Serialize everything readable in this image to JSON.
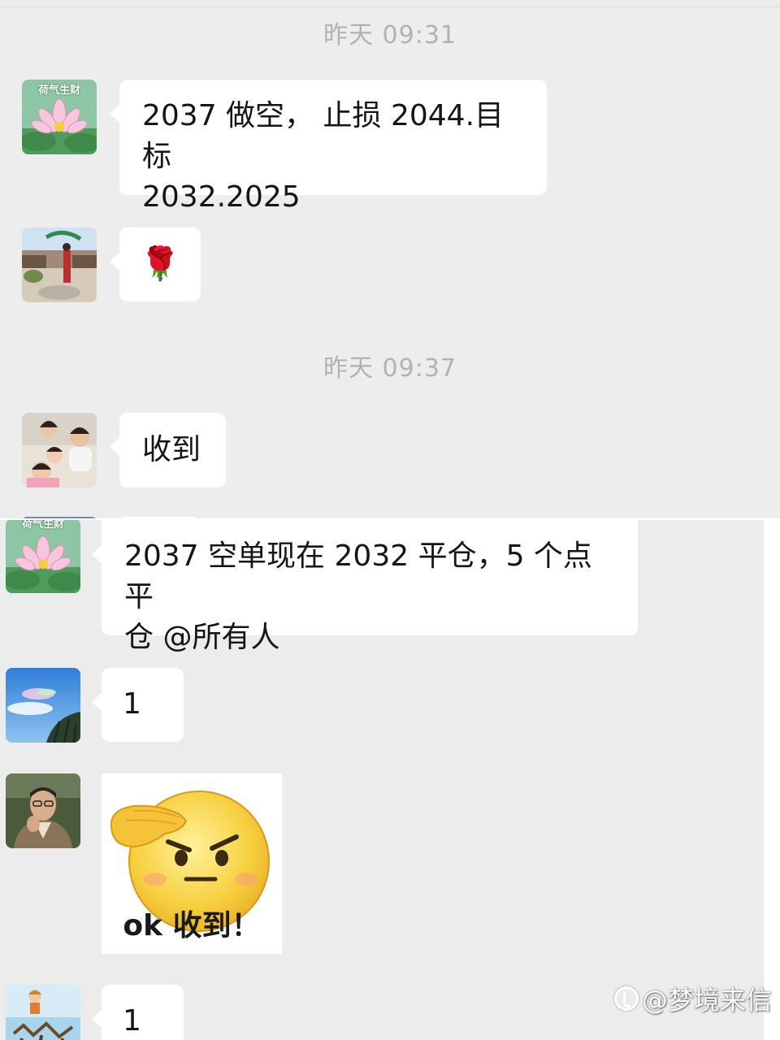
{
  "screen_one": {
    "timestamps": [
      "昨天 09:31",
      "昨天 09:37"
    ],
    "messages": [
      {
        "sender_avatar": "lotus-avatar",
        "avatar_label": "荷气生财",
        "text_lines": [
          "2037 做空，  止损 2044.目标",
          "2032.2025"
        ]
      },
      {
        "sender_avatar": "outdoor-photo-avatar",
        "emoji": "🌹"
      },
      {
        "sender_avatar": "family-photo-avatar",
        "text_lines": [
          "收到"
        ]
      }
    ]
  },
  "screen_two": {
    "messages": [
      {
        "sender_avatar": "lotus-avatar",
        "avatar_label": "荷气生财",
        "text_lines": [
          "2037 空单现在 2032 平仓，5 个点平",
          "仓 @所有人"
        ]
      },
      {
        "sender_avatar": "sky-photo-avatar",
        "text_lines": [
          "1"
        ]
      },
      {
        "sender_avatar": "man-portrait-avatar",
        "sticker": "salute-emoji-sticker",
        "sticker_caption": "ok 收到！"
      },
      {
        "sender_avatar": "cartoon-avatar",
        "text_lines": [
          "1"
        ]
      }
    ]
  },
  "watermark": {
    "text": "@梦境来信",
    "icon": "platform-logo-icon"
  },
  "colors": {
    "background": "#ededed",
    "bubble": "#ffffff",
    "timestamp": "#b2b2b2"
  }
}
